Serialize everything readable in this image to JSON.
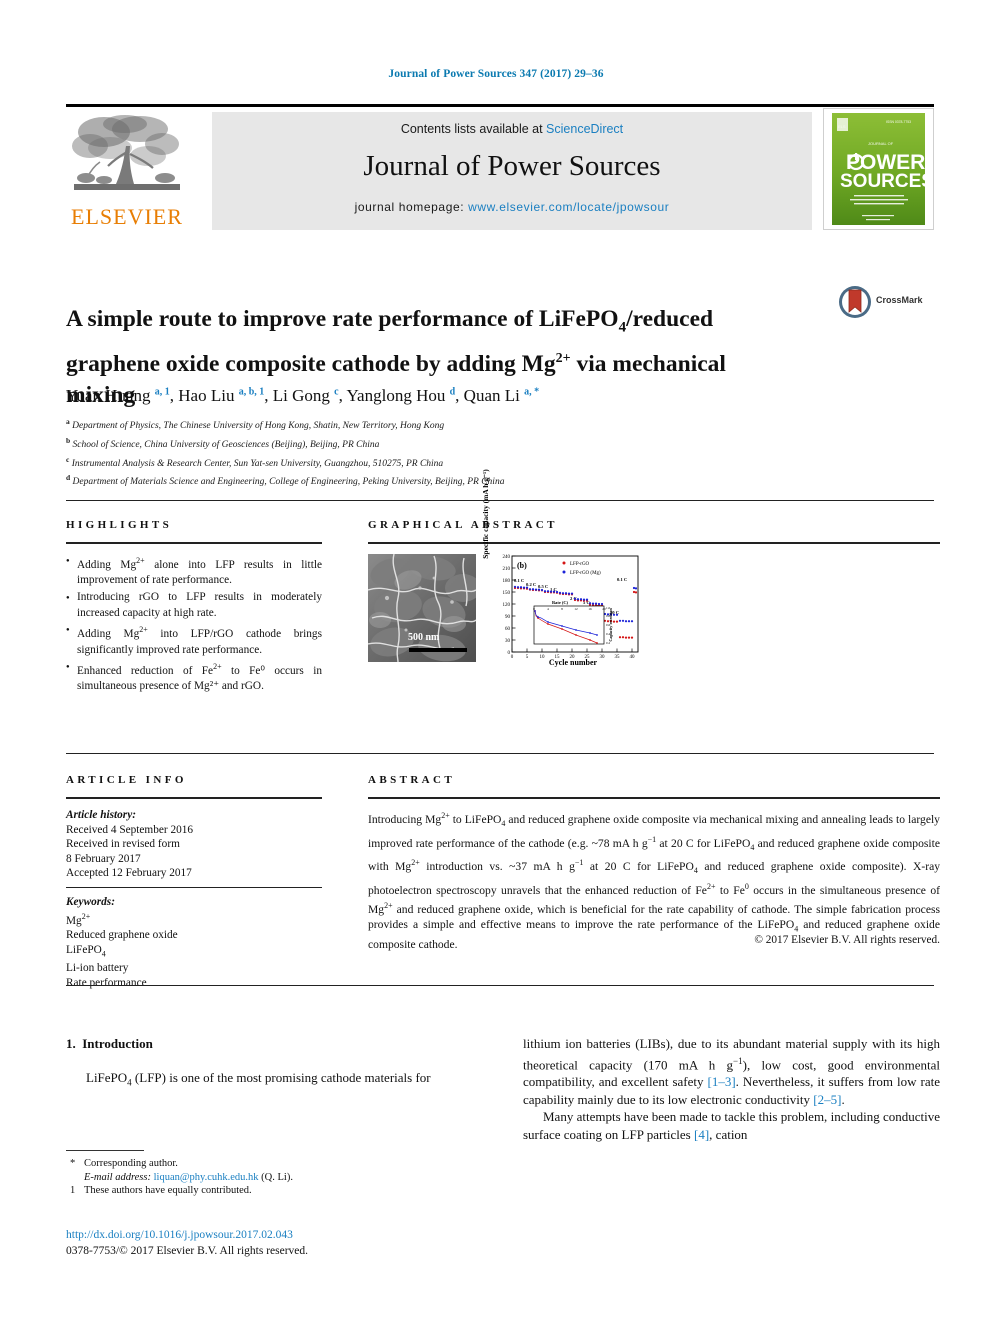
{
  "running_head": "Journal of Power Sources 347 (2017) 29–36",
  "masthead": {
    "elsevier_wordmark": "ELSEVIER",
    "contents_prefix": "Contents lists available at ",
    "contents_link": "ScienceDirect",
    "journal_name": "Journal of Power Sources",
    "homepage_prefix": "journal homepage: ",
    "homepage_url": "www.elsevier.com/locate/jpowsour",
    "cover": {
      "line1": "JOURNAL OF",
      "title1": "POWER",
      "title2": "SOURCES",
      "tagline": "An international journal devoted to research and development of electrochemical power sources"
    }
  },
  "article": {
    "title_part1": "A simple route to improve rate performance of LiFePO",
    "title_sub1": "4",
    "title_part2": "/reduced graphene oxide composite cathode by adding Mg",
    "title_sup1": "2+",
    "title_part3": " via mechanical mixing",
    "crossmark_label": "CrossMark",
    "authors": [
      {
        "name": "Yuan Huang",
        "marks": "a, 1",
        "sep": ", "
      },
      {
        "name": "Hao Liu",
        "marks": "a, b, 1",
        "sep": ", "
      },
      {
        "name": "Li Gong",
        "marks": "c",
        "sep": ", "
      },
      {
        "name": "Yanglong Hou",
        "marks": "d",
        "sep": ", "
      },
      {
        "name": "Quan Li",
        "marks": "a, *",
        "sep": ""
      }
    ],
    "affiliations": [
      {
        "mark": "a",
        "text": "Department of Physics, The Chinese University of Hong Kong, Shatin, New Territory, Hong Kong"
      },
      {
        "mark": "b",
        "text": "School of Science, China University of Geosciences (Beijing), Beijing, PR China"
      },
      {
        "mark": "c",
        "text": "Instrumental Analysis & Research Center, Sun Yat-sen University, Guangzhou, 510275, PR China"
      },
      {
        "mark": "d",
        "text": "Department of Materials Science and Engineering, College of Engineering, Peking University, Beijing, PR China"
      }
    ]
  },
  "highlights": {
    "heading": "HIGHLIGHTS",
    "items": [
      {
        "pre": "Adding Mg",
        "sup": "2+",
        "post": " alone into LFP results in little improvement of rate performance."
      },
      {
        "pre": "Introducing rGO to LFP results in moderately increased capacity at high rate.",
        "sup": "",
        "post": ""
      },
      {
        "pre": "Adding Mg",
        "sup": "2+",
        "post": " into LFP/rGO cathode brings significantly improved rate performance."
      },
      {
        "pre": "Enhanced reduction of Fe",
        "sup": "2+",
        "post": " to Fe⁰ occurs in simultaneous presence of Mg²⁺ and rGO."
      }
    ]
  },
  "article_info": {
    "heading": "ARTICLE INFO",
    "history_label": "Article history:",
    "history_lines": [
      "Received 4 September 2016",
      "Received in revised form",
      "8 February 2017",
      "Accepted 12 February 2017"
    ],
    "keywords_label": "Keywords:",
    "keywords": [
      "Mg2+",
      "Reduced graphene oxide",
      "LiFePO4",
      "Li-ion battery",
      "Rate performance"
    ]
  },
  "graphical_abstract": {
    "heading": "GRAPHICAL ABSTRACT",
    "sem_scalebar": "500 nm"
  },
  "chart_data": {
    "type": "scatter",
    "panel_label": "(b)",
    "title": "",
    "xlabel": "Cycle number",
    "ylabel": "Specific capacity (mA h g⁻¹)",
    "xlim": [
      0,
      42
    ],
    "ylim": [
      0,
      240
    ],
    "xticks": [
      0,
      5,
      10,
      15,
      20,
      25,
      30,
      35,
      40
    ],
    "yticks": [
      0,
      30,
      60,
      90,
      120,
      150,
      180,
      210,
      240
    ],
    "grid": false,
    "legend_position": "top-right",
    "legend": [
      "LFP-rGO",
      "LFP-rGO (Mg)"
    ],
    "colors": {
      "LFP-rGO": "#d41515",
      "LFP-rGO (Mg)": "#1b22d8"
    },
    "rate_annotations": [
      "0.1 C",
      "0.2 C",
      "0.5 C",
      "1 C",
      "2 C",
      "5 C",
      "10 C",
      "20 C",
      "0.1 C"
    ],
    "series": [
      {
        "name": "LFP-rGO",
        "color": "#d41515",
        "points": [
          [
            1,
            160
          ],
          [
            2,
            160
          ],
          [
            3,
            159
          ],
          [
            4,
            159
          ],
          [
            5,
            158
          ],
          [
            6,
            156
          ],
          [
            7,
            155
          ],
          [
            8,
            155
          ],
          [
            9,
            154
          ],
          [
            10,
            154
          ],
          [
            11,
            150
          ],
          [
            12,
            150
          ],
          [
            13,
            149
          ],
          [
            14,
            149
          ],
          [
            15,
            148
          ],
          [
            16,
            146
          ],
          [
            17,
            145
          ],
          [
            18,
            145
          ],
          [
            19,
            144
          ],
          [
            20,
            144
          ],
          [
            21,
            130
          ],
          [
            22,
            129
          ],
          [
            23,
            129
          ],
          [
            24,
            128
          ],
          [
            25,
            128
          ],
          [
            26,
            118
          ],
          [
            27,
            117
          ],
          [
            28,
            117
          ],
          [
            29,
            116
          ],
          [
            30,
            116
          ],
          [
            31,
            78
          ],
          [
            32,
            77
          ],
          [
            33,
            77
          ],
          [
            34,
            76
          ],
          [
            35,
            76
          ],
          [
            36,
            37
          ],
          [
            37,
            37
          ],
          [
            38,
            36
          ],
          [
            39,
            36
          ],
          [
            40,
            36
          ],
          [
            41,
            150
          ],
          [
            42,
            149
          ]
        ]
      },
      {
        "name": "LFP-rGO (Mg)",
        "color": "#1b22d8",
        "points": [
          [
            1,
            163
          ],
          [
            2,
            162
          ],
          [
            3,
            162
          ],
          [
            4,
            161
          ],
          [
            5,
            161
          ],
          [
            6,
            157
          ],
          [
            7,
            157
          ],
          [
            8,
            156
          ],
          [
            9,
            156
          ],
          [
            10,
            155
          ],
          [
            11,
            152
          ],
          [
            12,
            152
          ],
          [
            13,
            151
          ],
          [
            14,
            151
          ],
          [
            15,
            150
          ],
          [
            16,
            148
          ],
          [
            17,
            147
          ],
          [
            18,
            147
          ],
          [
            19,
            146
          ],
          [
            20,
            146
          ],
          [
            21,
            133
          ],
          [
            22,
            132
          ],
          [
            23,
            132
          ],
          [
            24,
            131
          ],
          [
            25,
            131
          ],
          [
            26,
            122
          ],
          [
            27,
            121
          ],
          [
            28,
            121
          ],
          [
            29,
            120
          ],
          [
            30,
            120
          ],
          [
            31,
            95
          ],
          [
            32,
            94
          ],
          [
            33,
            94
          ],
          [
            34,
            93
          ],
          [
            35,
            93
          ],
          [
            36,
            78
          ],
          [
            37,
            78
          ],
          [
            38,
            77
          ],
          [
            39,
            77
          ],
          [
            40,
            77
          ],
          [
            41,
            160
          ],
          [
            42,
            159
          ]
        ]
      }
    ],
    "inset": {
      "type": "line",
      "xlabel": "Rate (C)",
      "ylabel": "Capacity retention",
      "xlim": [
        0,
        20
      ],
      "ylim": [
        0.2,
        1.0
      ],
      "xticks": [
        0,
        4,
        8,
        12,
        16,
        20
      ],
      "yticks": [
        0.2,
        0.4,
        0.6,
        0.8,
        1.0
      ],
      "series": [
        {
          "name": "LFP-rGO",
          "color": "#d41515",
          "x": [
            0.1,
            0.2,
            0.5,
            1,
            2,
            5,
            10,
            20
          ],
          "y": [
            1.0,
            0.96,
            0.92,
            0.9,
            0.81,
            0.73,
            0.48,
            0.23
          ]
        },
        {
          "name": "LFP-rGO (Mg)",
          "color": "#1b22d8",
          "x": [
            0.1,
            0.2,
            0.5,
            1,
            2,
            5,
            10,
            20
          ],
          "y": [
            1.0,
            0.96,
            0.93,
            0.9,
            0.82,
            0.75,
            0.58,
            0.47
          ]
        }
      ]
    }
  },
  "abstract": {
    "heading": "ABSTRACT",
    "body_1": "Introducing Mg",
    "sup_1": "2+",
    "body_2": " to LiFePO",
    "sub_1": "4",
    "body_3": " and reduced graphene oxide composite via mechanical mixing and annealing leads to largely improved rate performance of the cathode (e.g. ~78 mA h g",
    "sup_2": "−1",
    "body_4": " at 20 C for LiFePO",
    "sub_2": "4",
    "body_5": " and reduced graphene oxide composite with Mg",
    "sup_3": "2+",
    "body_6": " introduction vs. ~37 mA h g",
    "sup_4": "−1",
    "body_7": " at 20 C for LiFePO",
    "sub_3": "4",
    "body_8": " and reduced graphene oxide composite). X-ray photoelectron spectroscopy unravels that the enhanced reduction of Fe",
    "sup_5": "2+",
    "body_9": " to Fe",
    "sup_6": "0",
    "body_10": " occurs in the simultaneous presence of Mg",
    "sup_7": "2+",
    "body_11": " and reduced graphene oxide, which is beneficial for the rate capability of cathode. The simple fabrication process provides a simple and effective means to improve the rate performance of the LiFePO",
    "sub_4": "4",
    "body_12": " and reduced graphene oxide composite cathode.",
    "copyright": "© 2017 Elsevier B.V. All rights reserved."
  },
  "body": {
    "section_number": "1.",
    "section_title": "Introduction",
    "left_para_1a": "LiFePO",
    "left_para_sub": "4",
    "left_para_1b": " (LFP) is one of the most promising cathode materials for",
    "right_para_1a": "lithium ion batteries (LIBs), due to its abundant material supply with its high theoretical capacity (170 mA h g",
    "right_sup_1": "−1",
    "right_para_1b": "), low cost, good environmental compatibility, and excellent safety ",
    "right_ref_1": "[1–3]",
    "right_para_1c": ". Nevertheless, it suffers from low rate capability mainly due to its low electronic conductivity ",
    "right_ref_2": "[2–5]",
    "right_para_1d": ".",
    "right_para_2a": "Many attempts have been made to tackle this problem, including conductive surface coating on LFP particles ",
    "right_ref_3": "[4]",
    "right_para_2b": ", cation"
  },
  "footnotes": {
    "corr_mark": "*",
    "corr_text": "Corresponding author.",
    "email_label": "E-mail address:",
    "email": "liquan@phy.cuhk.edu.hk",
    "email_suffix": "(Q. Li).",
    "eq_mark": "1",
    "eq_text": "These authors have equally contributed.",
    "doi": "http://dx.doi.org/10.1016/j.jpowsour.2017.02.043",
    "issn": "0378-7753/© 2017 Elsevier B.V. All rights reserved."
  },
  "colors": {
    "link": "#1a7fc1",
    "elsevier_orange": "#E87E04",
    "panel_grey": "#e7e7e7",
    "cover_green": "#78ad2a",
    "series_red": "#d41515",
    "series_blue": "#1b22d8"
  }
}
